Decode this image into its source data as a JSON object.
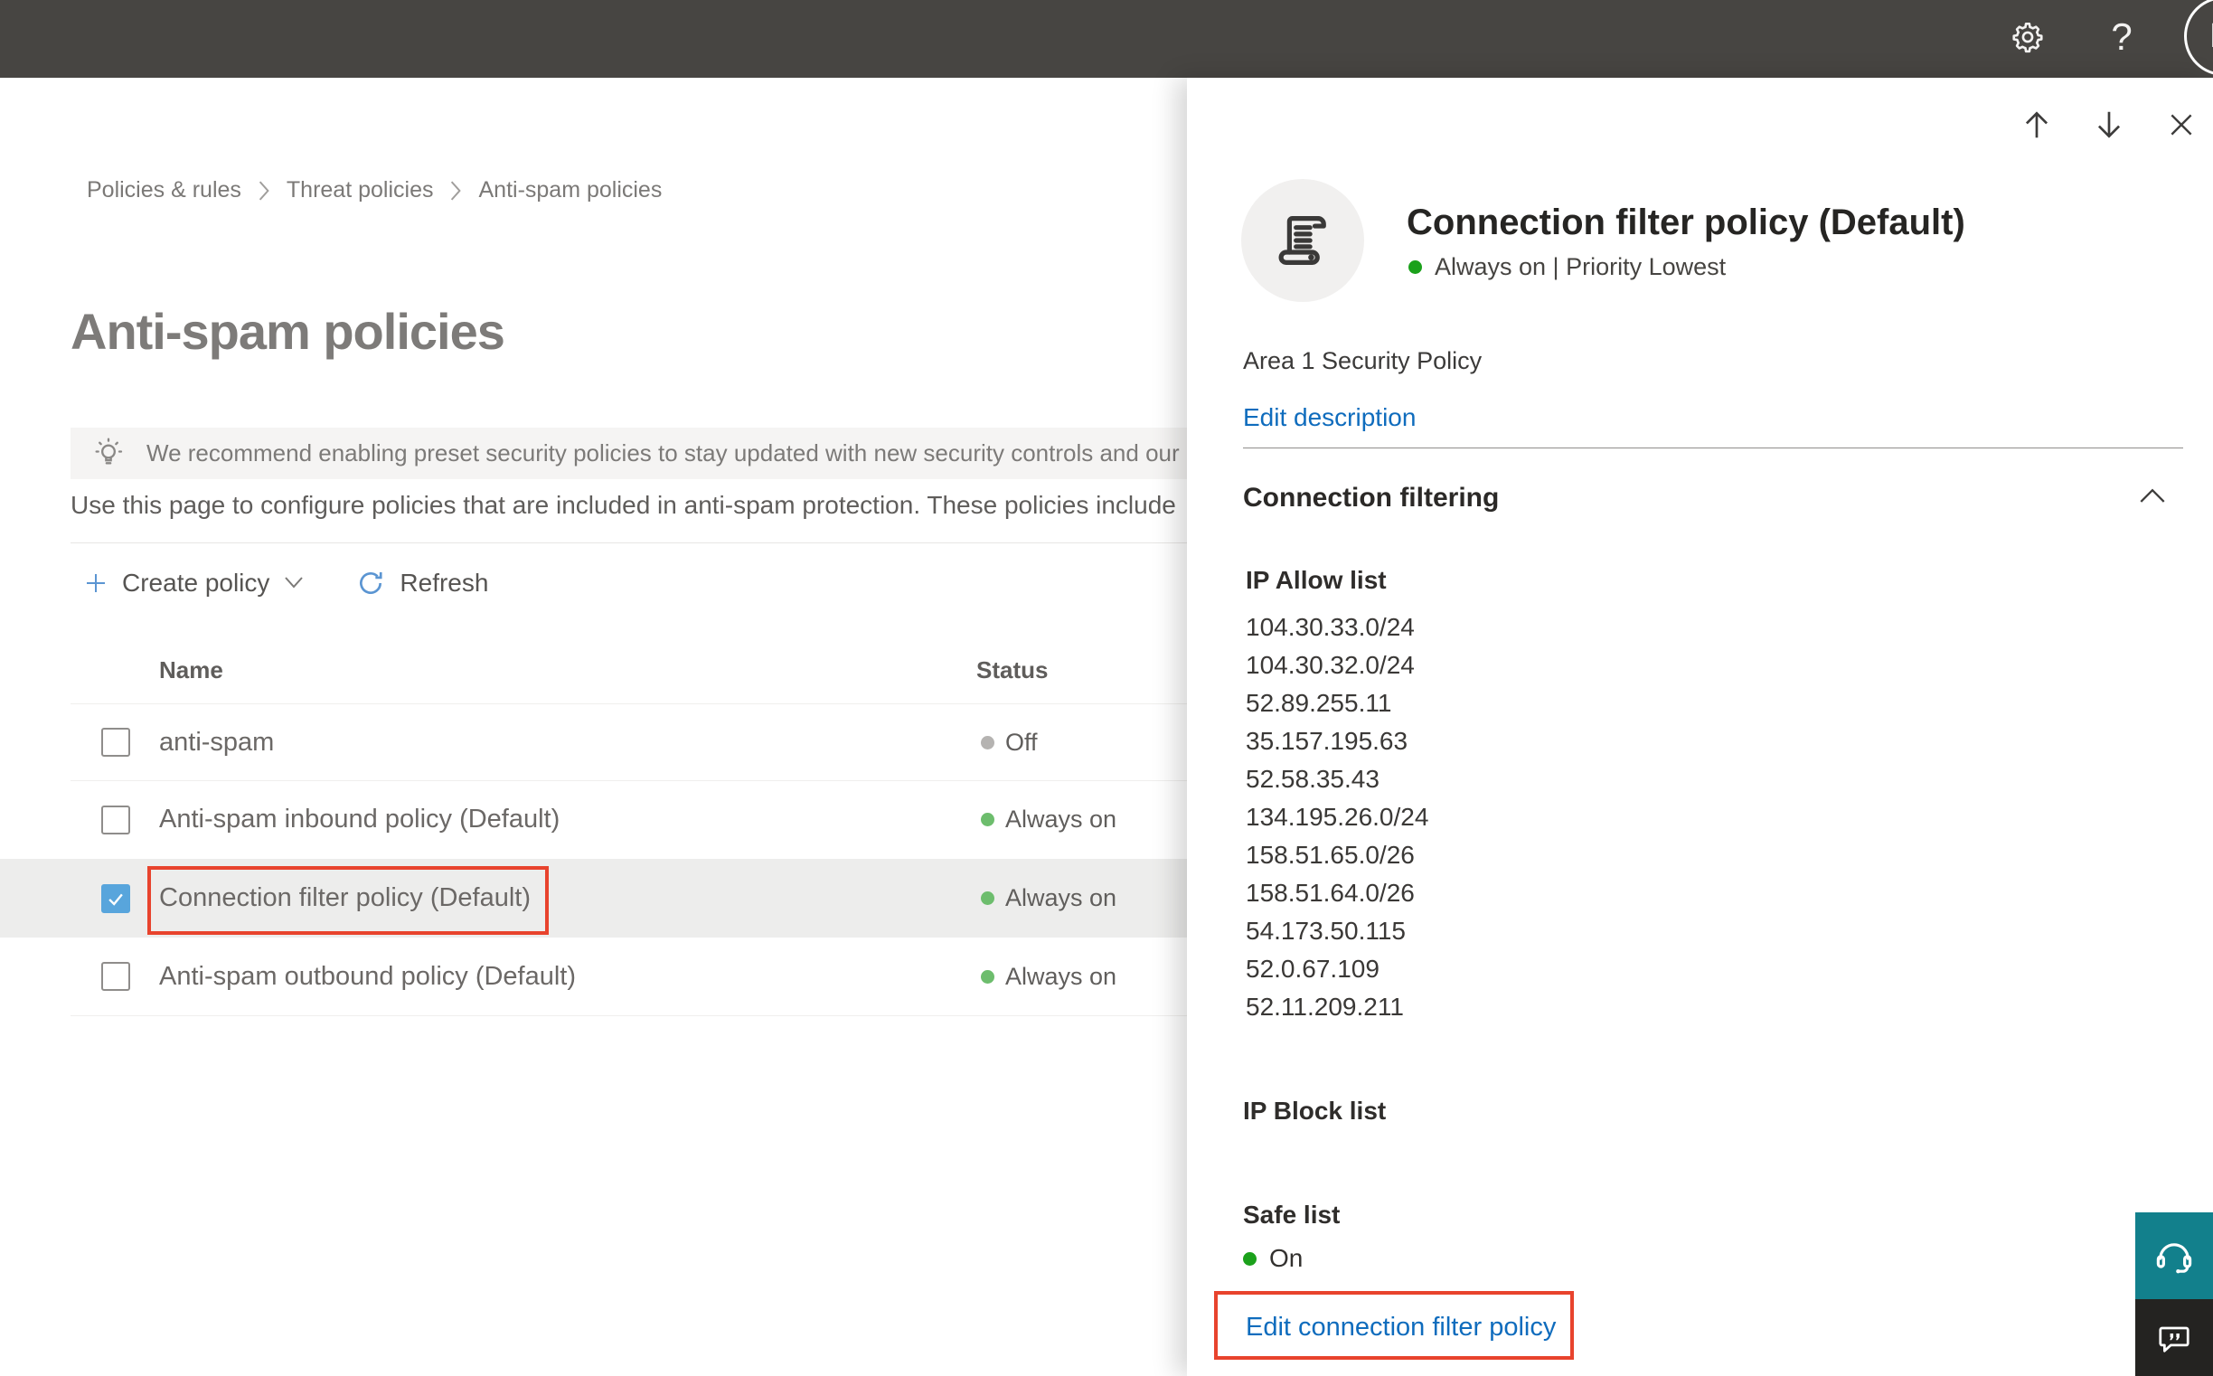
{
  "topbar": {
    "avatar_initial": "M",
    "help_label": "?"
  },
  "breadcrumb": {
    "items": [
      "Policies & rules",
      "Threat policies",
      "Anti-spam policies"
    ]
  },
  "page": {
    "title": "Anti-spam policies",
    "banner_text": "We recommend enabling preset security policies to stay updated with new security controls and our recomme",
    "intro_text": "Use this page to configure policies that are included in anti-spam protection. These policies include"
  },
  "toolbar": {
    "create_policy_label": "Create policy",
    "refresh_label": "Refresh"
  },
  "table": {
    "columns": {
      "name": "Name",
      "status": "Status"
    },
    "rows": [
      {
        "name": "anti-spam",
        "status": "Off",
        "state": "off",
        "checked": false
      },
      {
        "name": "Anti-spam inbound policy (Default)",
        "status": "Always on",
        "state": "on",
        "checked": false
      },
      {
        "name": "Connection filter policy (Default)",
        "status": "Always on",
        "state": "on",
        "checked": true
      },
      {
        "name": "Anti-spam outbound policy (Default)",
        "status": "Always on",
        "state": "on",
        "checked": false
      }
    ]
  },
  "flyout": {
    "title": "Connection filter policy (Default)",
    "status_line": "Always on | Priority Lowest",
    "description": "Area 1 Security Policy",
    "edit_description_label": "Edit description",
    "section_title": "Connection filtering",
    "ip_allow": {
      "label": "IP Allow list",
      "ips": [
        "104.30.33.0/24",
        "104.30.32.0/24",
        "52.89.255.11",
        "35.157.195.63",
        "52.58.35.43",
        "134.195.26.0/24",
        "158.51.65.0/26",
        "158.51.64.0/26",
        "54.173.50.115",
        "52.0.67.109",
        "52.11.209.211"
      ]
    },
    "ip_block_label": "IP Block list",
    "safe_list_label": "Safe list",
    "safe_list_status": "On",
    "edit_policy_label": "Edit connection filter policy"
  },
  "colors": {
    "topbar": "#474542",
    "link_blue": "#0f6cbd",
    "toolbar_icon_blue": "#5b95d2",
    "status_on_green_table": "#6dbd6d",
    "status_on_green_flyout": "#1ba11b",
    "status_off_gray": "#b5b3b1",
    "checkbox_checked": "#58a5dc",
    "annotation_red": "#e8432d",
    "selected_row_bg": "#ededec",
    "support_teal": "#12808c",
    "feedback_dark": "#242321"
  }
}
